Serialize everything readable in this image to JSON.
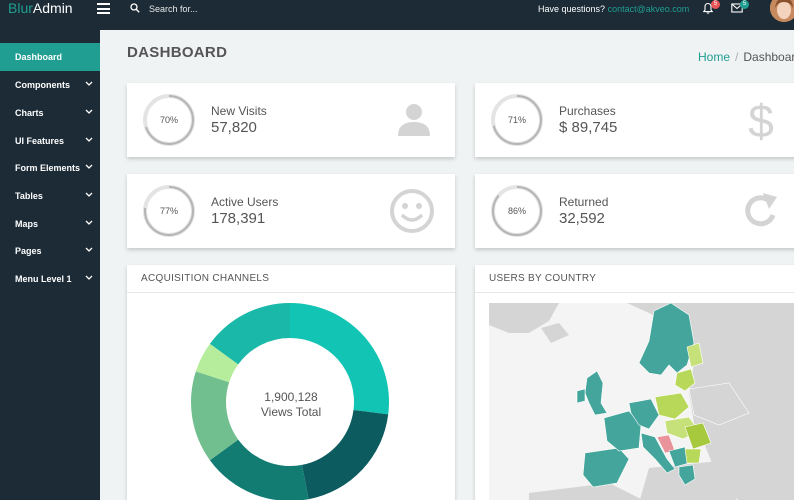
{
  "app": {
    "logo_part1": "Blur",
    "logo_part2": "Admin"
  },
  "header": {
    "search_placeholder": "Search for...",
    "questions_label": "Have questions?",
    "contact_email": "contact@akveo.com",
    "notifications_count": "5",
    "messages_count": "5"
  },
  "sidebar": {
    "items": [
      {
        "label": "Dashboard",
        "active": true,
        "has_chevron": false
      },
      {
        "label": "Components",
        "active": false,
        "has_chevron": true
      },
      {
        "label": "Charts",
        "active": false,
        "has_chevron": true
      },
      {
        "label": "UI Features",
        "active": false,
        "has_chevron": true
      },
      {
        "label": "Form Elements",
        "active": false,
        "has_chevron": true
      },
      {
        "label": "Tables",
        "active": false,
        "has_chevron": true
      },
      {
        "label": "Maps",
        "active": false,
        "has_chevron": true
      },
      {
        "label": "Pages",
        "active": false,
        "has_chevron": true
      },
      {
        "label": "Menu Level 1",
        "active": false,
        "has_chevron": true
      }
    ]
  },
  "page": {
    "title": "DASHBOARD",
    "breadcrumb_home": "Home",
    "breadcrumb_sep": "/",
    "breadcrumb_current": "Dashboard"
  },
  "stats": [
    {
      "percent_label": "70%",
      "percent": 70,
      "label": "New Visits",
      "value": "57,820",
      "icon": "user-icon"
    },
    {
      "percent_label": "71%",
      "percent": 71,
      "label": "Purchases",
      "value": "$ 89,745",
      "icon": "dollar-icon"
    },
    {
      "percent_label": "77%",
      "percent": 77,
      "label": "Active Users",
      "value": "178,391",
      "icon": "smiley-icon"
    },
    {
      "percent_label": "86%",
      "percent": 86,
      "label": "Returned",
      "value": "32,592",
      "icon": "refresh-icon"
    }
  ],
  "acquisition": {
    "title": "ACQUISITION CHANNELS",
    "total_value": "1,900,128",
    "total_label": "Views Total",
    "segments": [
      {
        "color": "#12c4b4",
        "share": 0.27
      },
      {
        "color": "#0b5b5f",
        "share": 0.2
      },
      {
        "color": "#127c72",
        "share": 0.18
      },
      {
        "color": "#71be8e",
        "share": 0.15
      },
      {
        "color": "#b6ed9c",
        "share": 0.05
      },
      {
        "color": "#1ab8a8",
        "share": 0.15
      }
    ]
  },
  "country": {
    "title": "USERS BY COUNTRY"
  },
  "colors": {
    "sidebar_bg": "#1c2b36",
    "accent": "#209e91",
    "page_bg": "#f0f3f4",
    "ring_track": "#e4e4e4",
    "ring_fill": "#b5b5b5",
    "icon_gray": "#d4d4d4",
    "map_land": "#d5d5d5",
    "map_teal": "#43a59b",
    "map_lime": "#b8d85a",
    "map_pink": "#e8949a"
  }
}
